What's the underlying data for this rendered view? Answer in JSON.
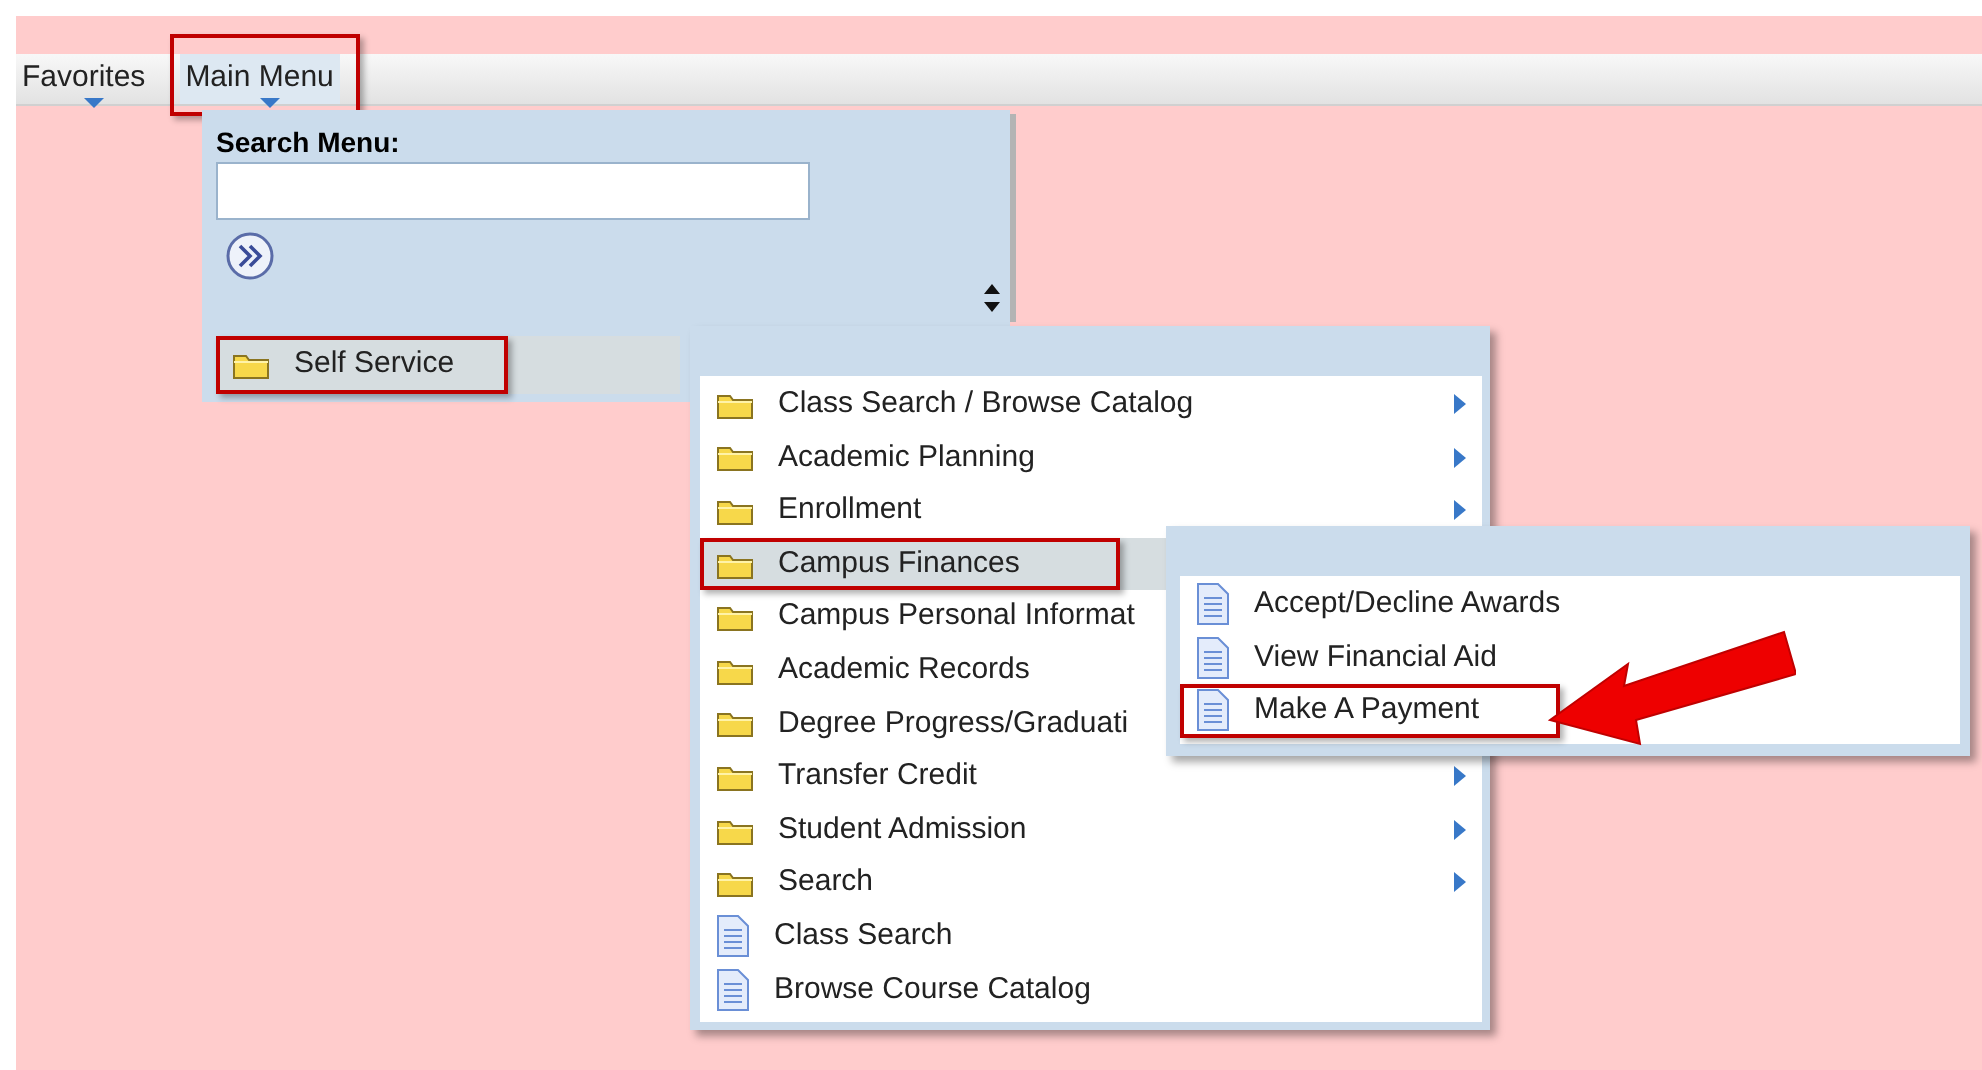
{
  "menu_bar": {
    "items": [
      {
        "label": "Favorites",
        "outlined": false
      },
      {
        "label": "Main Menu",
        "outlined": true
      }
    ]
  },
  "main_menu": {
    "search_label": "Search Menu:",
    "items": [
      {
        "label": "Self Service",
        "kind": "folder",
        "selected": true,
        "outlined": true
      }
    ]
  },
  "submenu": {
    "items": [
      {
        "label": "Class Search / Browse Catalog",
        "kind": "folder",
        "arrow": true,
        "selected": false,
        "outlined": false
      },
      {
        "label": "Academic Planning",
        "kind": "folder",
        "arrow": true,
        "selected": false,
        "outlined": false
      },
      {
        "label": "Enrollment",
        "kind": "folder",
        "arrow": true,
        "selected": false,
        "outlined": false
      },
      {
        "label": "Campus Finances",
        "kind": "folder",
        "arrow": false,
        "selected": true,
        "outlined": true
      },
      {
        "label": "Campus Personal Informat",
        "kind": "folder",
        "arrow": false,
        "selected": false,
        "outlined": false
      },
      {
        "label": "Academic Records",
        "kind": "folder",
        "arrow": false,
        "selected": false,
        "outlined": false
      },
      {
        "label": "Degree Progress/Graduati",
        "kind": "folder",
        "arrow": false,
        "selected": false,
        "outlined": false
      },
      {
        "label": "Transfer Credit",
        "kind": "folder",
        "arrow": true,
        "selected": false,
        "outlined": false
      },
      {
        "label": "Student Admission",
        "kind": "folder",
        "arrow": true,
        "selected": false,
        "outlined": false
      },
      {
        "label": "Search",
        "kind": "folder",
        "arrow": true,
        "selected": false,
        "outlined": false
      },
      {
        "label": "Class Search",
        "kind": "page",
        "arrow": false,
        "selected": false,
        "outlined": false
      },
      {
        "label": "Browse Course Catalog",
        "kind": "page",
        "arrow": false,
        "selected": false,
        "outlined": false
      }
    ]
  },
  "submenu_2": {
    "items": [
      {
        "label": "Accept/Decline Awards",
        "kind": "page",
        "selected": false,
        "outlined": false,
        "pointed": false
      },
      {
        "label": "View Financial Aid",
        "kind": "page",
        "selected": false,
        "outlined": false,
        "pointed": false
      },
      {
        "label": "Make A Payment",
        "kind": "page",
        "selected": false,
        "outlined": true,
        "pointed": true
      }
    ]
  }
}
